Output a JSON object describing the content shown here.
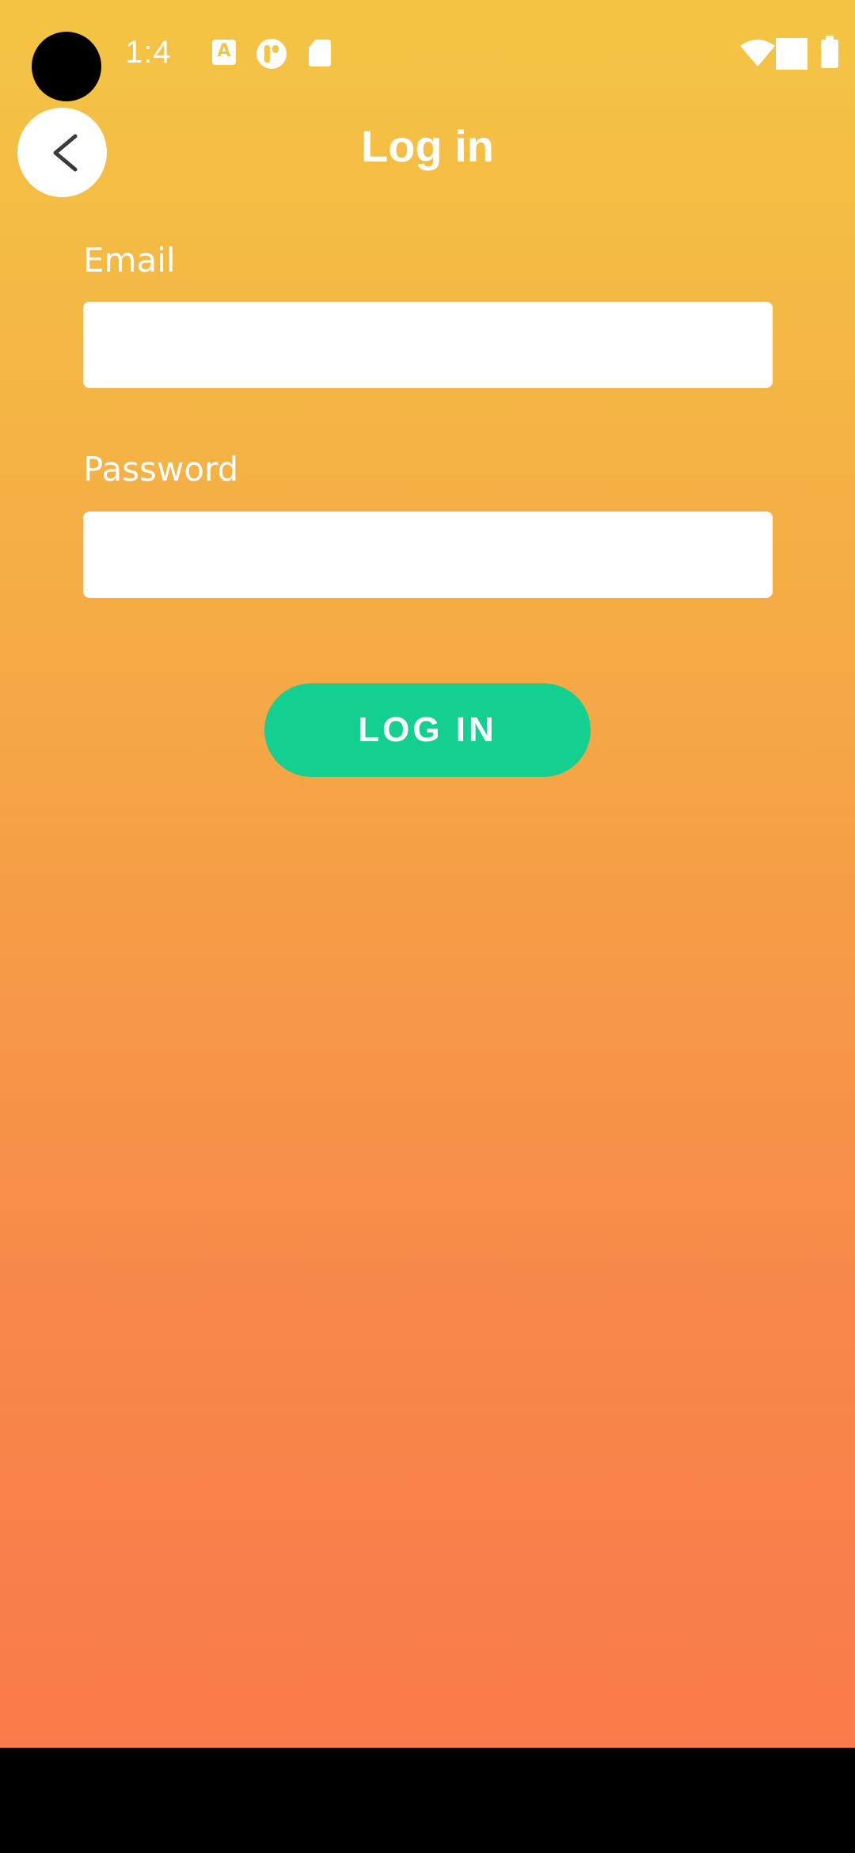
{
  "status_bar": {
    "time": "1:4 ",
    "notification_icons": [
      "text-a-icon",
      "app-t-icon",
      "sd-card-icon"
    ],
    "system_icons": [
      "wifi-icon",
      "signal-icon",
      "battery-icon"
    ],
    "icon_a_glyph": "A"
  },
  "header": {
    "title": "Log in",
    "back_icon": "chevron-left-icon"
  },
  "form": {
    "email_label": "Email",
    "email_value": "",
    "email_placeholder": "",
    "password_label": "Password",
    "password_value": "",
    "password_placeholder": "",
    "submit_label": "LOG IN"
  },
  "colors": {
    "gradient_top": "#F4C544",
    "gradient_bottom": "#F97A4A",
    "button": "#14D090",
    "text": "#FFFFFF"
  }
}
